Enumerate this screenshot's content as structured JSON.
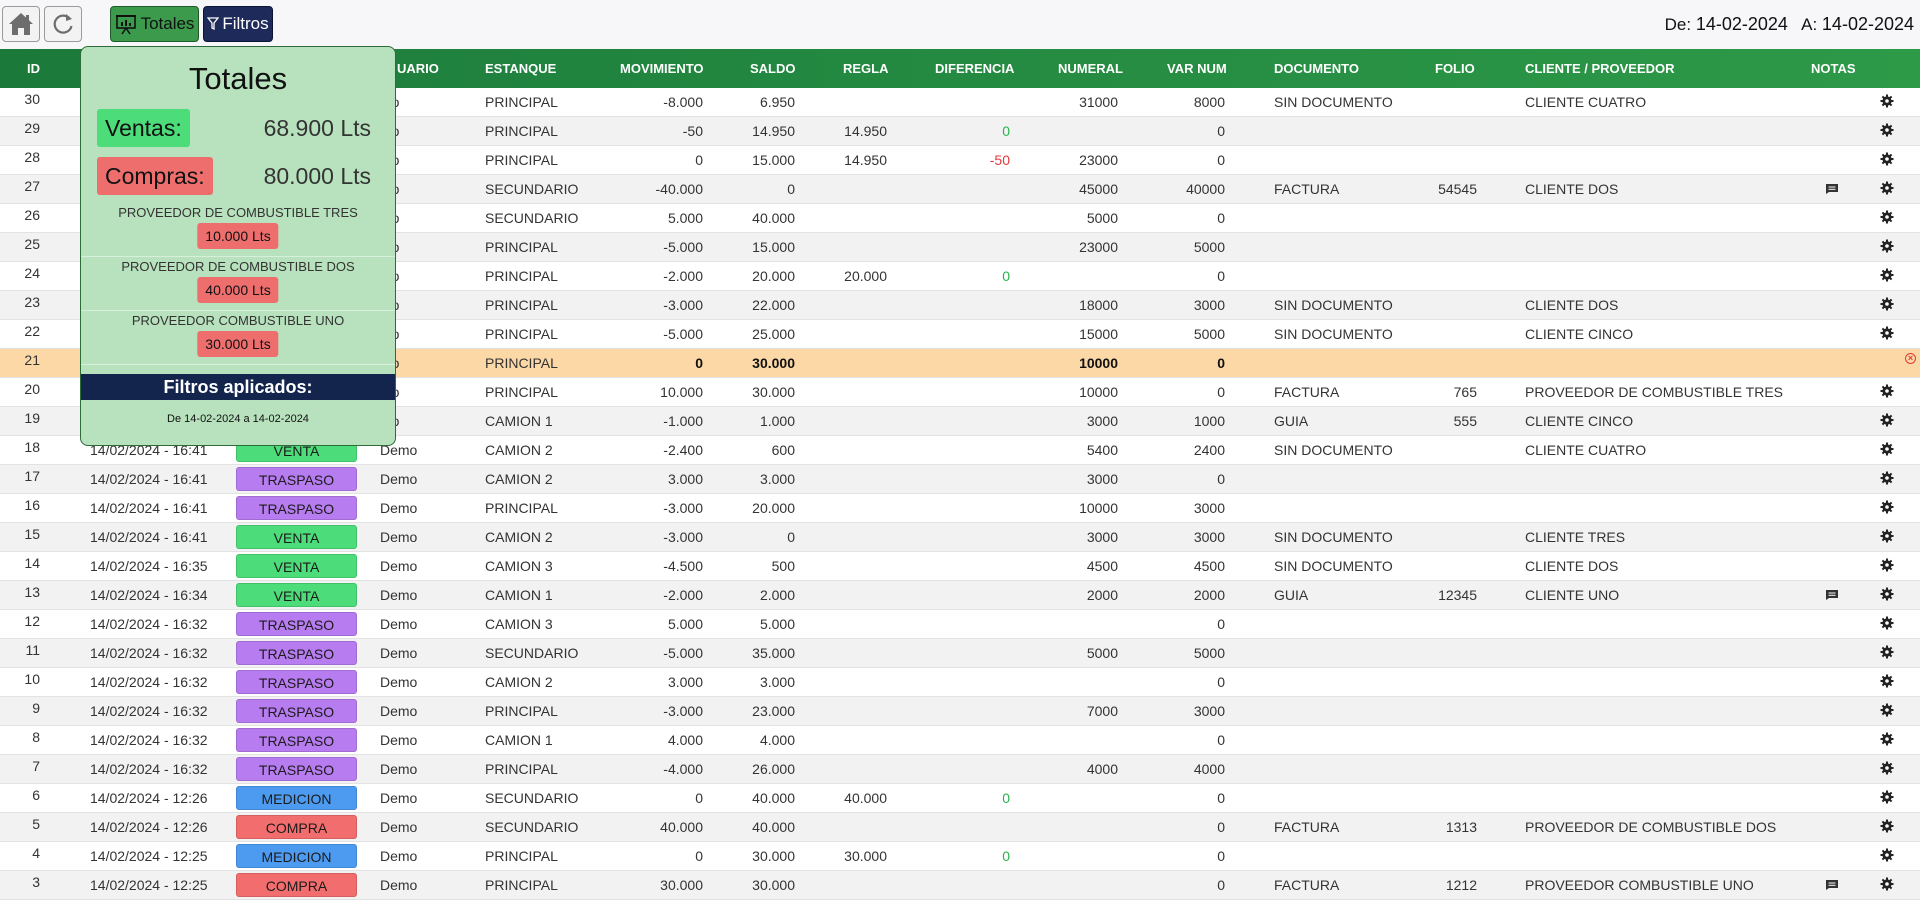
{
  "toolbar": {
    "home_icon": "home-icon",
    "refresh_icon": "refresh-icon",
    "totales_label": "Totales",
    "filtros_label": "Filtros",
    "date_from_label": "De:",
    "date_from": "14-02-2024",
    "date_to_label": "A:",
    "date_to": "14-02-2024"
  },
  "table": {
    "headers": {
      "id": "ID",
      "usuario": "UARIO",
      "estanque": "ESTANQUE",
      "movimiento": "MOVIMIENTO",
      "saldo": "SALDO",
      "regla": "REGLA",
      "diferencia": "DIFERENCIA",
      "numeral": "NUMERAL",
      "var_num": "VAR NUM",
      "documento": "DOCUMENTO",
      "folio": "FOLIO",
      "cliente": "CLIENTE / PROVEEDOR",
      "notas": "NOTAS"
    },
    "rows": [
      {
        "id": "30",
        "fecha": "",
        "tipo": "",
        "usuario": "mo",
        "estanque": "PRINCIPAL",
        "movimiento": "-8.000",
        "saldo": "6.950",
        "regla": "",
        "diferencia": "",
        "numeral": "31000",
        "var_num": "8000",
        "documento": "SIN DOCUMENTO",
        "folio": "",
        "cliente": "CLIENTE CUATRO",
        "nota": false
      },
      {
        "id": "29",
        "fecha": "",
        "tipo": "",
        "usuario": "mo",
        "estanque": "PRINCIPAL",
        "movimiento": "-50",
        "saldo": "14.950",
        "regla": "14.950",
        "diferencia": "0",
        "numeral": "",
        "var_num": "0",
        "documento": "",
        "folio": "",
        "cliente": "",
        "nota": false
      },
      {
        "id": "28",
        "fecha": "",
        "tipo": "",
        "usuario": "mo",
        "estanque": "PRINCIPAL",
        "movimiento": "0",
        "saldo": "15.000",
        "regla": "14.950",
        "diferencia": "-50",
        "numeral": "23000",
        "var_num": "0",
        "documento": "",
        "folio": "",
        "cliente": "",
        "nota": false
      },
      {
        "id": "27",
        "fecha": "",
        "tipo": "",
        "usuario": "mo",
        "estanque": "SECUNDARIO",
        "movimiento": "-40.000",
        "saldo": "0",
        "regla": "",
        "diferencia": "",
        "numeral": "45000",
        "var_num": "40000",
        "documento": "FACTURA",
        "folio": "54545",
        "cliente": "CLIENTE DOS",
        "nota": true
      },
      {
        "id": "26",
        "fecha": "",
        "tipo": "",
        "usuario": "mo",
        "estanque": "SECUNDARIO",
        "movimiento": "5.000",
        "saldo": "40.000",
        "regla": "",
        "diferencia": "",
        "numeral": "5000",
        "var_num": "0",
        "documento": "",
        "folio": "",
        "cliente": "",
        "nota": false
      },
      {
        "id": "25",
        "fecha": "",
        "tipo": "",
        "usuario": "mo",
        "estanque": "PRINCIPAL",
        "movimiento": "-5.000",
        "saldo": "15.000",
        "regla": "",
        "diferencia": "",
        "numeral": "23000",
        "var_num": "5000",
        "documento": "",
        "folio": "",
        "cliente": "",
        "nota": false
      },
      {
        "id": "24",
        "fecha": "",
        "tipo": "",
        "usuario": "mo",
        "estanque": "PRINCIPAL",
        "movimiento": "-2.000",
        "saldo": "20.000",
        "regla": "20.000",
        "diferencia": "0",
        "numeral": "",
        "var_num": "0",
        "documento": "",
        "folio": "",
        "cliente": "",
        "nota": false
      },
      {
        "id": "23",
        "fecha": "",
        "tipo": "",
        "usuario": "mo",
        "estanque": "PRINCIPAL",
        "movimiento": "-3.000",
        "saldo": "22.000",
        "regla": "",
        "diferencia": "",
        "numeral": "18000",
        "var_num": "3000",
        "documento": "SIN DOCUMENTO",
        "folio": "",
        "cliente": "CLIENTE DOS",
        "nota": false
      },
      {
        "id": "22",
        "fecha": "",
        "tipo": "",
        "usuario": "mo",
        "estanque": "PRINCIPAL",
        "movimiento": "-5.000",
        "saldo": "25.000",
        "regla": "",
        "diferencia": "",
        "numeral": "15000",
        "var_num": "5000",
        "documento": "SIN DOCUMENTO",
        "folio": "",
        "cliente": "CLIENTE CINCO",
        "nota": false
      },
      {
        "id": "21",
        "fecha": "",
        "tipo": "",
        "usuario": "mo",
        "estanque": "PRINCIPAL",
        "movimiento": "0",
        "saldo": "30.000",
        "regla": "",
        "diferencia": "",
        "numeral": "10000",
        "var_num": "0",
        "documento": "",
        "folio": "",
        "cliente": "",
        "nota": false,
        "highlight": true
      },
      {
        "id": "20",
        "fecha": "",
        "tipo": "",
        "usuario": "mo",
        "estanque": "PRINCIPAL",
        "movimiento": "10.000",
        "saldo": "30.000",
        "regla": "",
        "diferencia": "",
        "numeral": "10000",
        "var_num": "0",
        "documento": "FACTURA",
        "folio": "765",
        "cliente": "PROVEEDOR DE COMBUSTIBLE TRES",
        "nota": false
      },
      {
        "id": "19",
        "fecha": "",
        "tipo": "",
        "usuario": "mo",
        "estanque": "CAMION 1",
        "movimiento": "-1.000",
        "saldo": "1.000",
        "regla": "",
        "diferencia": "",
        "numeral": "3000",
        "var_num": "1000",
        "documento": "GUIA",
        "folio": "555",
        "cliente": "CLIENTE CINCO",
        "nota": false
      },
      {
        "id": "18",
        "fecha": "14/02/2024 - 16:41",
        "tipo": "VENTA",
        "usuario": "Demo",
        "estanque": "CAMION 2",
        "movimiento": "-2.400",
        "saldo": "600",
        "regla": "",
        "diferencia": "",
        "numeral": "5400",
        "var_num": "2400",
        "documento": "SIN DOCUMENTO",
        "folio": "",
        "cliente": "CLIENTE CUATRO",
        "nota": false
      },
      {
        "id": "17",
        "fecha": "14/02/2024 - 16:41",
        "tipo": "TRASPASO",
        "usuario": "Demo",
        "estanque": "CAMION 2",
        "movimiento": "3.000",
        "saldo": "3.000",
        "regla": "",
        "diferencia": "",
        "numeral": "3000",
        "var_num": "0",
        "documento": "",
        "folio": "",
        "cliente": "",
        "nota": false
      },
      {
        "id": "16",
        "fecha": "14/02/2024 - 16:41",
        "tipo": "TRASPASO",
        "usuario": "Demo",
        "estanque": "PRINCIPAL",
        "movimiento": "-3.000",
        "saldo": "20.000",
        "regla": "",
        "diferencia": "",
        "numeral": "10000",
        "var_num": "3000",
        "documento": "",
        "folio": "",
        "cliente": "",
        "nota": false
      },
      {
        "id": "15",
        "fecha": "14/02/2024 - 16:41",
        "tipo": "VENTA",
        "usuario": "Demo",
        "estanque": "CAMION 2",
        "movimiento": "-3.000",
        "saldo": "0",
        "regla": "",
        "diferencia": "",
        "numeral": "3000",
        "var_num": "3000",
        "documento": "SIN DOCUMENTO",
        "folio": "",
        "cliente": "CLIENTE TRES",
        "nota": false
      },
      {
        "id": "14",
        "fecha": "14/02/2024 - 16:35",
        "tipo": "VENTA",
        "usuario": "Demo",
        "estanque": "CAMION 3",
        "movimiento": "-4.500",
        "saldo": "500",
        "regla": "",
        "diferencia": "",
        "numeral": "4500",
        "var_num": "4500",
        "documento": "SIN DOCUMENTO",
        "folio": "",
        "cliente": "CLIENTE DOS",
        "nota": false
      },
      {
        "id": "13",
        "fecha": "14/02/2024 - 16:34",
        "tipo": "VENTA",
        "usuario": "Demo",
        "estanque": "CAMION 1",
        "movimiento": "-2.000",
        "saldo": "2.000",
        "regla": "",
        "diferencia": "",
        "numeral": "2000",
        "var_num": "2000",
        "documento": "GUIA",
        "folio": "12345",
        "cliente": "CLIENTE UNO",
        "nota": true
      },
      {
        "id": "12",
        "fecha": "14/02/2024 - 16:32",
        "tipo": "TRASPASO",
        "usuario": "Demo",
        "estanque": "CAMION 3",
        "movimiento": "5.000",
        "saldo": "5.000",
        "regla": "",
        "diferencia": "",
        "numeral": "",
        "var_num": "0",
        "documento": "",
        "folio": "",
        "cliente": "",
        "nota": false
      },
      {
        "id": "11",
        "fecha": "14/02/2024 - 16:32",
        "tipo": "TRASPASO",
        "usuario": "Demo",
        "estanque": "SECUNDARIO",
        "movimiento": "-5.000",
        "saldo": "35.000",
        "regla": "",
        "diferencia": "",
        "numeral": "5000",
        "var_num": "5000",
        "documento": "",
        "folio": "",
        "cliente": "",
        "nota": false
      },
      {
        "id": "10",
        "fecha": "14/02/2024 - 16:32",
        "tipo": "TRASPASO",
        "usuario": "Demo",
        "estanque": "CAMION 2",
        "movimiento": "3.000",
        "saldo": "3.000",
        "regla": "",
        "diferencia": "",
        "numeral": "",
        "var_num": "0",
        "documento": "",
        "folio": "",
        "cliente": "",
        "nota": false
      },
      {
        "id": "9",
        "fecha": "14/02/2024 - 16:32",
        "tipo": "TRASPASO",
        "usuario": "Demo",
        "estanque": "PRINCIPAL",
        "movimiento": "-3.000",
        "saldo": "23.000",
        "regla": "",
        "diferencia": "",
        "numeral": "7000",
        "var_num": "3000",
        "documento": "",
        "folio": "",
        "cliente": "",
        "nota": false
      },
      {
        "id": "8",
        "fecha": "14/02/2024 - 16:32",
        "tipo": "TRASPASO",
        "usuario": "Demo",
        "estanque": "CAMION 1",
        "movimiento": "4.000",
        "saldo": "4.000",
        "regla": "",
        "diferencia": "",
        "numeral": "",
        "var_num": "0",
        "documento": "",
        "folio": "",
        "cliente": "",
        "nota": false
      },
      {
        "id": "7",
        "fecha": "14/02/2024 - 16:32",
        "tipo": "TRASPASO",
        "usuario": "Demo",
        "estanque": "PRINCIPAL",
        "movimiento": "-4.000",
        "saldo": "26.000",
        "regla": "",
        "diferencia": "",
        "numeral": "4000",
        "var_num": "4000",
        "documento": "",
        "folio": "",
        "cliente": "",
        "nota": false
      },
      {
        "id": "6",
        "fecha": "14/02/2024 - 12:26",
        "tipo": "MEDICION",
        "usuario": "Demo",
        "estanque": "SECUNDARIO",
        "movimiento": "0",
        "saldo": "40.000",
        "regla": "40.000",
        "diferencia": "0",
        "numeral": "",
        "var_num": "0",
        "documento": "",
        "folio": "",
        "cliente": "",
        "nota": false
      },
      {
        "id": "5",
        "fecha": "14/02/2024 - 12:26",
        "tipo": "COMPRA",
        "usuario": "Demo",
        "estanque": "SECUNDARIO",
        "movimiento": "40.000",
        "saldo": "40.000",
        "regla": "",
        "diferencia": "",
        "numeral": "",
        "var_num": "0",
        "documento": "FACTURA",
        "folio": "1313",
        "cliente": "PROVEEDOR DE COMBUSTIBLE DOS",
        "nota": false
      },
      {
        "id": "4",
        "fecha": "14/02/2024 - 12:25",
        "tipo": "MEDICION",
        "usuario": "Demo",
        "estanque": "PRINCIPAL",
        "movimiento": "0",
        "saldo": "30.000",
        "regla": "30.000",
        "diferencia": "0",
        "numeral": "",
        "var_num": "0",
        "documento": "",
        "folio": "",
        "cliente": "",
        "nota": false
      },
      {
        "id": "3",
        "fecha": "14/02/2024 - 12:25",
        "tipo": "COMPRA",
        "usuario": "Demo",
        "estanque": "PRINCIPAL",
        "movimiento": "30.000",
        "saldo": "30.000",
        "regla": "",
        "diferencia": "",
        "numeral": "",
        "var_num": "0",
        "documento": "FACTURA",
        "folio": "1212",
        "cliente": "PROVEEDOR COMBUSTIBLE UNO",
        "nota": true
      }
    ]
  },
  "tipo_colors": {
    "VENTA": "#4cdc7a",
    "TRASPASO": "#b77cf0",
    "MEDICION": "#4d9bf0",
    "COMPRA": "#f26d6d"
  },
  "totales": {
    "title": "Totales",
    "ventas_label": "Ventas:",
    "ventas_value": "68.900 Lts",
    "compras_label": "Compras:",
    "compras_value": "80.000 Lts",
    "proveedores": [
      {
        "name": "PROVEEDOR DE COMBUSTIBLE TRES",
        "value": "10.000 Lts"
      },
      {
        "name": "PROVEEDOR DE COMBUSTIBLE DOS",
        "value": "40.000 Lts"
      },
      {
        "name": "PROVEEDOR COMBUSTIBLE UNO",
        "value": "30.000 Lts"
      }
    ],
    "filtros_title": "Filtros aplicados:",
    "filtros_range": "De 14-02-2024 a 14-02-2024"
  }
}
